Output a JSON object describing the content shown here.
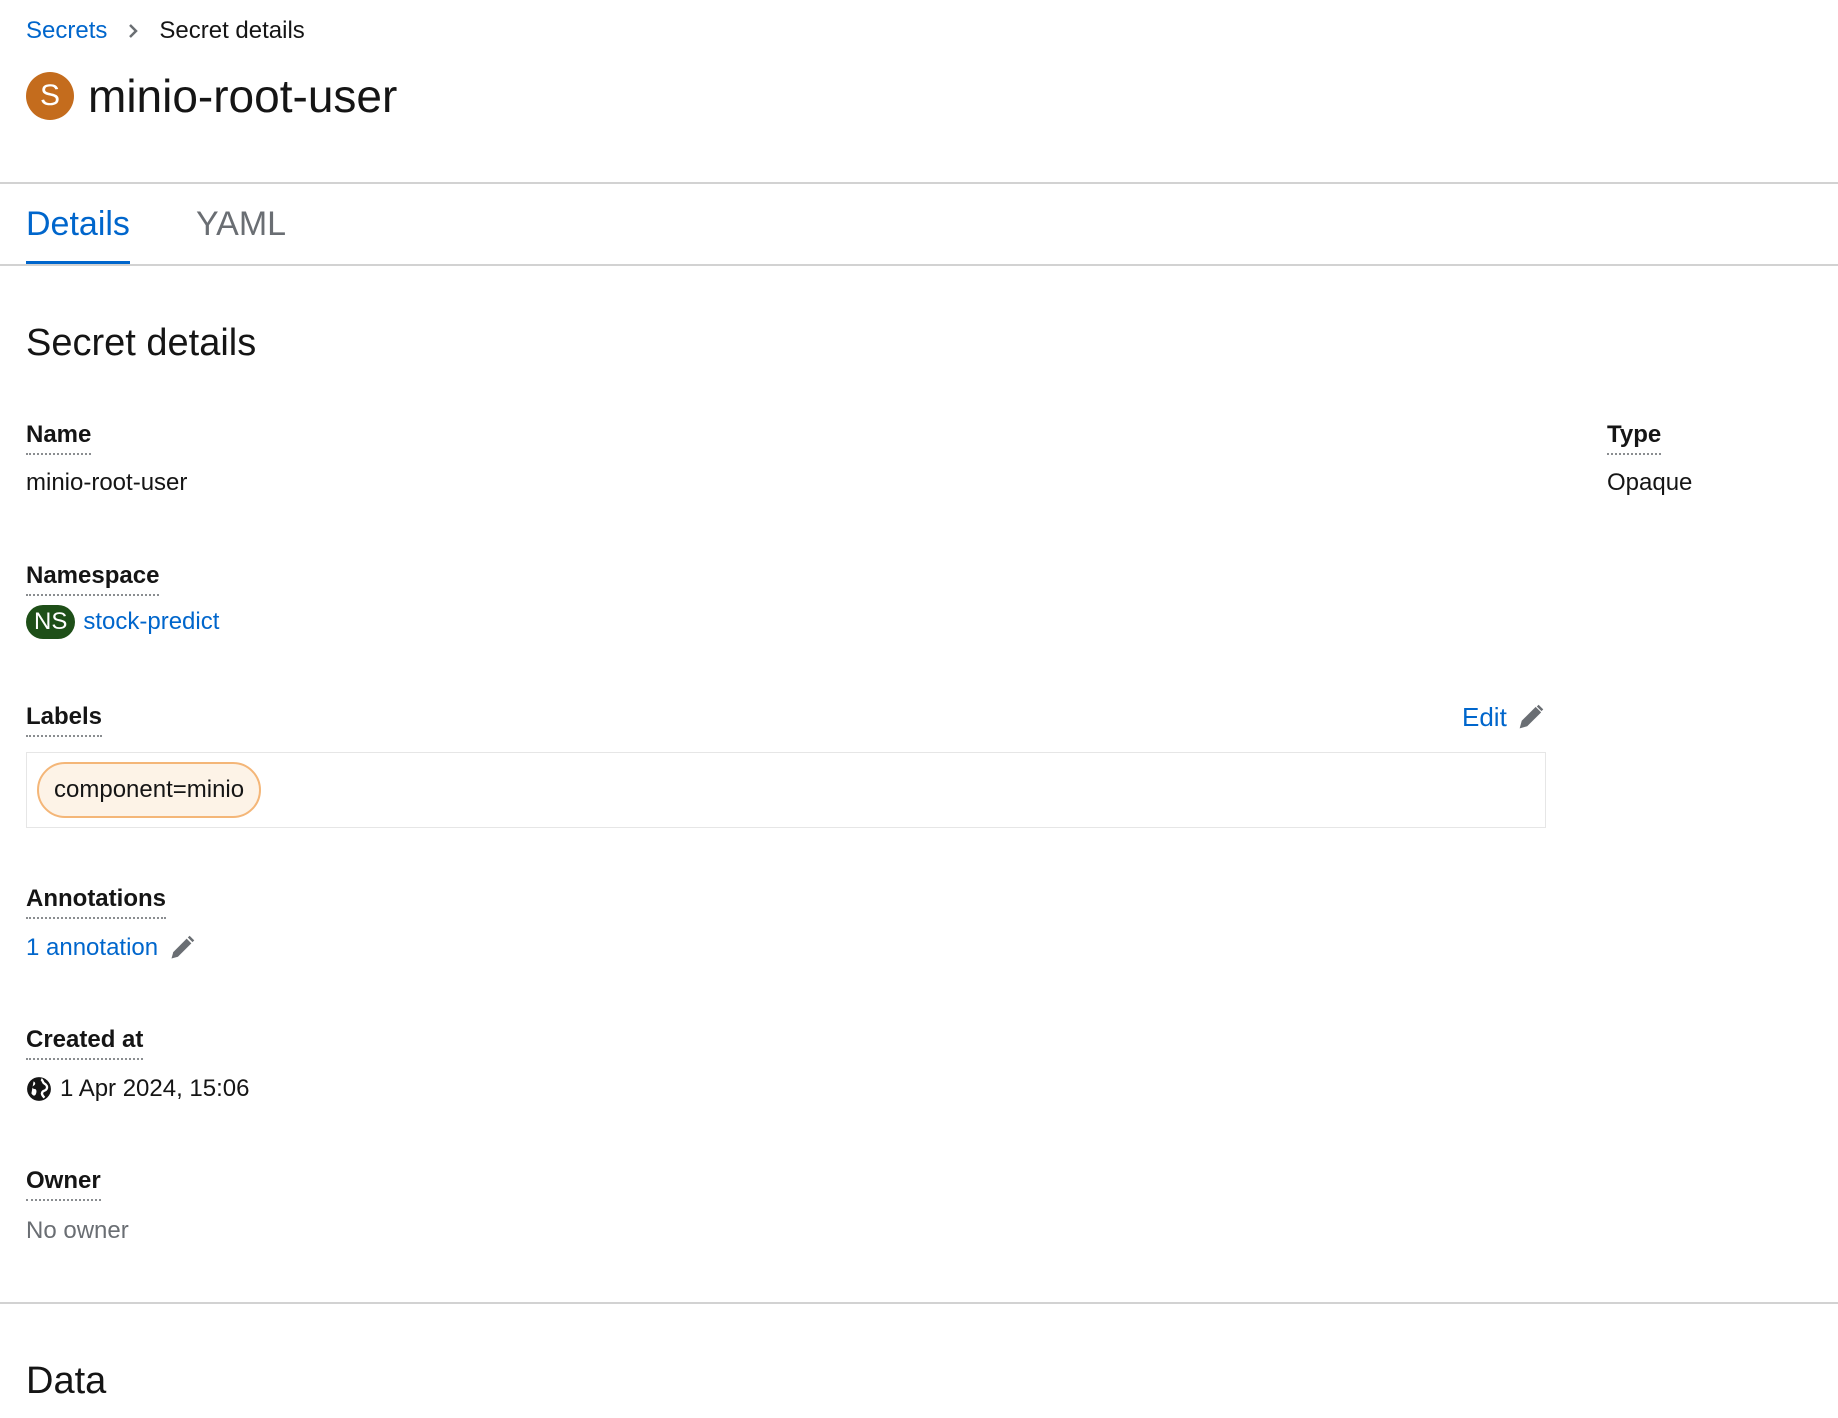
{
  "breadcrumb": {
    "parent": "Secrets",
    "current": "Secret details"
  },
  "header": {
    "badge": "S",
    "badge_color": "#c46c1d",
    "title": "minio-root-user"
  },
  "tabs": [
    {
      "label": "Details",
      "active": true
    },
    {
      "label": "YAML",
      "active": false
    }
  ],
  "details": {
    "heading": "Secret details",
    "name": {
      "label": "Name",
      "value": "minio-root-user"
    },
    "type": {
      "label": "Type",
      "value": "Opaque"
    },
    "namespace": {
      "label": "Namespace",
      "badge": "NS",
      "badge_color": "#1e4f18",
      "value": "stock-predict"
    },
    "labels": {
      "label": "Labels",
      "edit": "Edit",
      "items": [
        "component=minio"
      ]
    },
    "annotations": {
      "label": "Annotations",
      "value": "1 annotation"
    },
    "created_at": {
      "label": "Created at",
      "value": "1 Apr 2024, 15:06"
    },
    "owner": {
      "label": "Owner",
      "value": "No owner"
    }
  },
  "data_section": {
    "heading": "Data"
  },
  "colors": {
    "link": "#0066cc",
    "label_chip_border": "#f4b678",
    "label_chip_bg": "#fdf3e7"
  }
}
